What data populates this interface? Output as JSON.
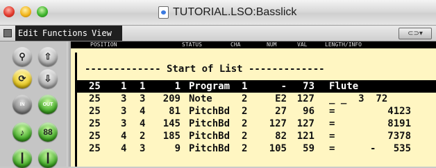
{
  "window": {
    "title": "TUTORIAL.LSO:Basslick"
  },
  "menu": {
    "items": [
      "Edit",
      "Functions",
      "View"
    ]
  },
  "header": {
    "position": "POSITION",
    "status": "STATUS",
    "cha": "CHA",
    "num": "NUM",
    "val": "VAL",
    "length": "LENGTH/INFO"
  },
  "list": {
    "start_label": "------------- Start of List -------------",
    "rows": [
      {
        "bar": "25",
        "beat": "1",
        "div": "1",
        "tick": "1",
        "status": "Program",
        "cha": "1",
        "num": "-",
        "val": "73",
        "info": "Flute",
        "selected": true
      },
      {
        "bar": "25",
        "beat": "3",
        "div": "3",
        "tick": "209",
        "status": "Note",
        "cha": "2",
        "num": "E2",
        "val": "127",
        "info": "_ _  3  72",
        "selected": false
      },
      {
        "bar": "25",
        "beat": "3",
        "div": "4",
        "tick": "81",
        "status": "PitchBd",
        "cha": "2",
        "num": "27",
        "val": "96",
        "info": "=         4123",
        "selected": false
      },
      {
        "bar": "25",
        "beat": "3",
        "div": "4",
        "tick": "145",
        "status": "PitchBd",
        "cha": "2",
        "num": "127",
        "val": "127",
        "info": "=         8191",
        "selected": false
      },
      {
        "bar": "25",
        "beat": "4",
        "div": "2",
        "tick": "185",
        "status": "PitchBd",
        "cha": "2",
        "num": "82",
        "val": "121",
        "info": "=         7378",
        "selected": false
      },
      {
        "bar": "25",
        "beat": "4",
        "div": "3",
        "tick": "9",
        "status": "PitchBd",
        "cha": "2",
        "num": "105",
        "val": "59",
        "info": "=      -   535",
        "selected": false
      }
    ]
  },
  "palette": {
    "buttons": [
      "walk-icon",
      "up-arrow-icon",
      "cycle-icon",
      "down-arrow-icon",
      "midi-in-icon",
      "midi-out-icon",
      "note-icon",
      "88",
      "fader-icon",
      "fader-2-icon"
    ],
    "labels": {
      "in": "IN",
      "out": "OUT",
      "b88": "88"
    }
  },
  "colors": {
    "list_bg": "#fff6c2",
    "selected_bg": "#000000"
  }
}
